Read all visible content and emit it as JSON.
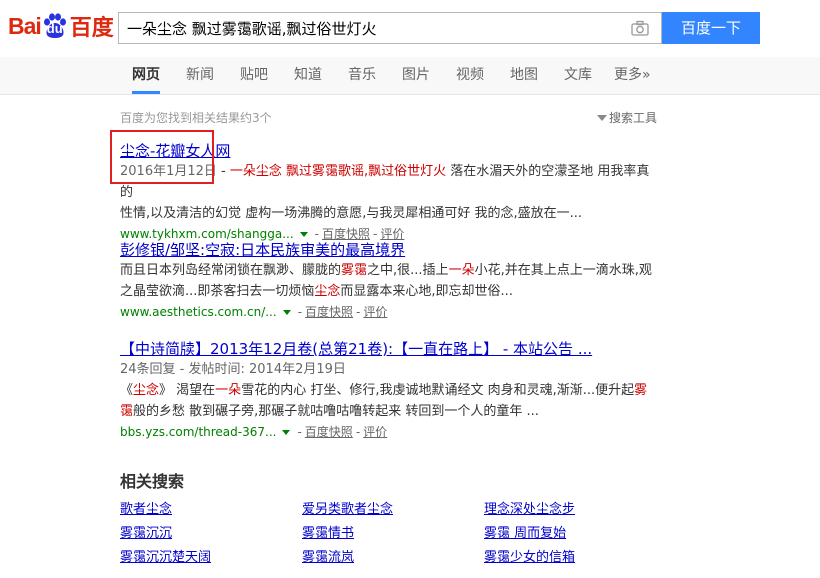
{
  "header": {
    "logo_text_left": "Bai",
    "logo_text_paw": "du",
    "logo_text_right": "百度",
    "search_query": "一朵尘念 飘过雾霭歌谣,飘过俗世灯火",
    "search_button": "百度一下",
    "brand_color": "#de2910",
    "button_color": "#3385ff"
  },
  "nav": {
    "items": [
      "网页",
      "新闻",
      "贴吧",
      "知道",
      "音乐",
      "图片",
      "视频",
      "地图",
      "文库",
      "更多»"
    ],
    "active": "网页"
  },
  "stats": "百度为您找到相关结果约3个",
  "tools_label": "搜索工具",
  "results": [
    {
      "title": "尘念-花瓣女人网",
      "date": "2016年1月12日",
      "dash": " - ",
      "abs_em": "一朵尘念 飘过雾霭歌谣,飘过俗世灯火",
      "abs_rest": " 落在水湄天外的空濛圣地 用我率真的",
      "abs_line2": "性情,以及清洁的幻觉 虚构一场沸腾的意愿,与我灵犀相通可好 我的念,盛放在一...",
      "url": "www.tykhxm.com/shangga...",
      "snapshot": "百度快照",
      "rating": "评价"
    },
    {
      "title": "彭修银/邹坚:空寂:日本民族审美的最高境界",
      "abs_a": "而且日本列岛经常闭锁在飘渺、朦胧的",
      "abs_em1": "雾霭",
      "abs_b": "之中,很...插上",
      "abs_em2": "一朵",
      "abs_c": "小花,并在其上点上一滴水珠,观",
      "abs_d": "之晶莹欲滴...即茶客扫去一切烦恼",
      "abs_em3": "尘念",
      "abs_e": "而显露本来心地,即忘却世俗...",
      "url": "www.aesthetics.com.cn/...",
      "snapshot": "百度快照",
      "rating": "评价"
    },
    {
      "title": "【中诗简牍】2013年12月卷(总第21卷):【一直在路上】 - 本站公告 ...",
      "meta": "24条回复 - 发帖时间: 2014年2月19日",
      "abs_a": "《",
      "abs_em1": "尘念",
      "abs_b": "》 渴望在",
      "abs_em2": "一朵",
      "abs_c": "雪花的内心 打坐、修行,我虔诚地默诵经文 肉身和灵魂,渐渐...便升起",
      "abs_em3": "雾",
      "abs_em4": "霭",
      "abs_d": "般的乡愁 散到碾子旁,那碾子就咕噜咕噜转起来 转回到一个人的童年 ...",
      "url": "bbs.yzs.com/thread-367...",
      "snapshot": "百度快照",
      "rating": "评价"
    }
  ],
  "related": {
    "title": "相关搜索",
    "links": [
      [
        "歌者尘念",
        "爱另类歌者尘念",
        "理念深处尘念步"
      ],
      [
        "雾霭沉沉",
        "雾霭情书",
        "雾霭 周而复始"
      ],
      [
        "雾霭沉沉楚天阔",
        "雾霭流岚",
        "雾霭少女的信箱"
      ]
    ]
  }
}
